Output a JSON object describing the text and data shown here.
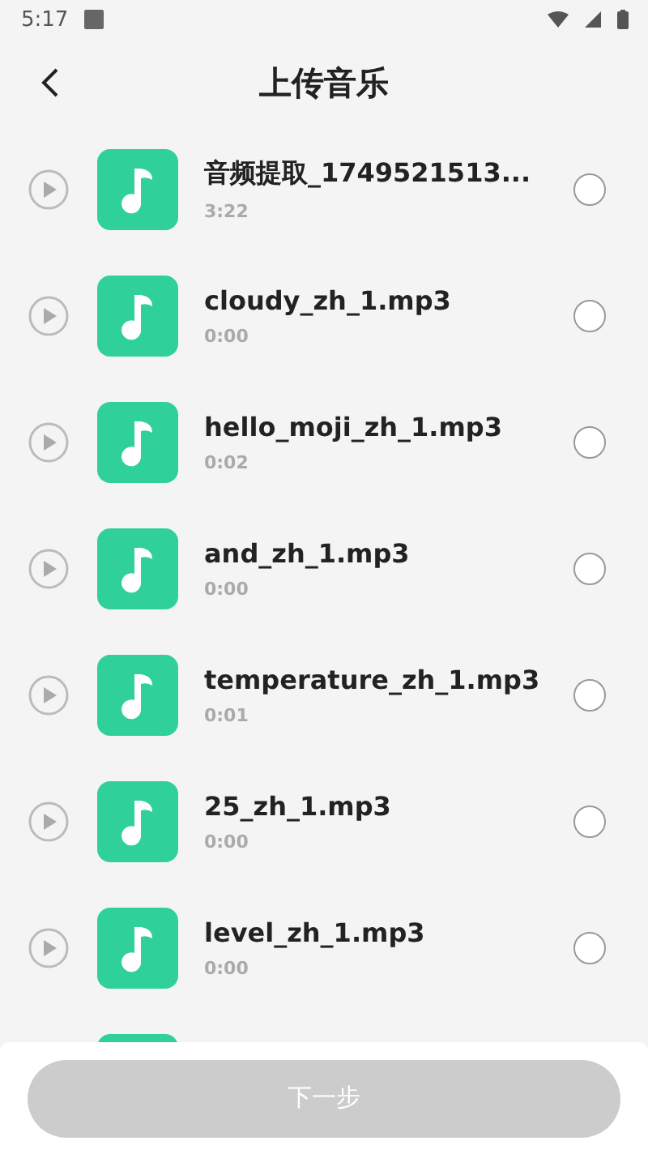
{
  "status_bar": {
    "time": "5:17"
  },
  "header": {
    "title": "上传音乐"
  },
  "tracks": [
    {
      "name": "音频提取_1749521513...",
      "duration": "3:22",
      "selected": false
    },
    {
      "name": "cloudy_zh_1.mp3",
      "duration": "0:00",
      "selected": false
    },
    {
      "name": "hello_moji_zh_1.mp3",
      "duration": "0:02",
      "selected": false
    },
    {
      "name": "and_zh_1.mp3",
      "duration": "0:00",
      "selected": false
    },
    {
      "name": "temperature_zh_1.mp3",
      "duration": "0:01",
      "selected": false
    },
    {
      "name": "25_zh_1.mp3",
      "duration": "0:00",
      "selected": false
    },
    {
      "name": "level_zh_1.mp3",
      "duration": "0:00",
      "selected": false
    }
  ],
  "next_button": {
    "label": "下一步",
    "disabled": true
  }
}
